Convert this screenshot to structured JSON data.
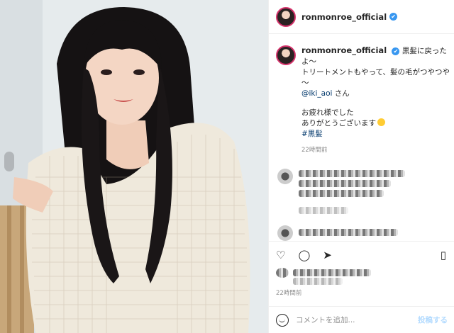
{
  "header": {
    "username": "ronmonroe_official",
    "verified_mark": "✔"
  },
  "caption": {
    "username": "ronmonroe_official",
    "line1": "黒髪に戻ったよ～",
    "line2": "トリートメントもやって、髪の毛がつやつや～",
    "mention": "@iki_aoi",
    "mention_suffix": " さん",
    "line3": "お疲れ様でした",
    "line4": "ありがとうございます",
    "hashtag": "#黒髪",
    "time": "22時間前"
  },
  "actions": {
    "like_icon": "heart-icon",
    "comment_icon": "comment-icon",
    "share_icon": "share-icon",
    "save_icon": "bookmark-icon"
  },
  "post_time": "22時間前",
  "comment_box": {
    "placeholder": "コメントを追加...",
    "post_label": "投稿する"
  },
  "colors": {
    "verified": "#3897f0",
    "link": "#00376b",
    "post_button": "#b3dbff"
  }
}
